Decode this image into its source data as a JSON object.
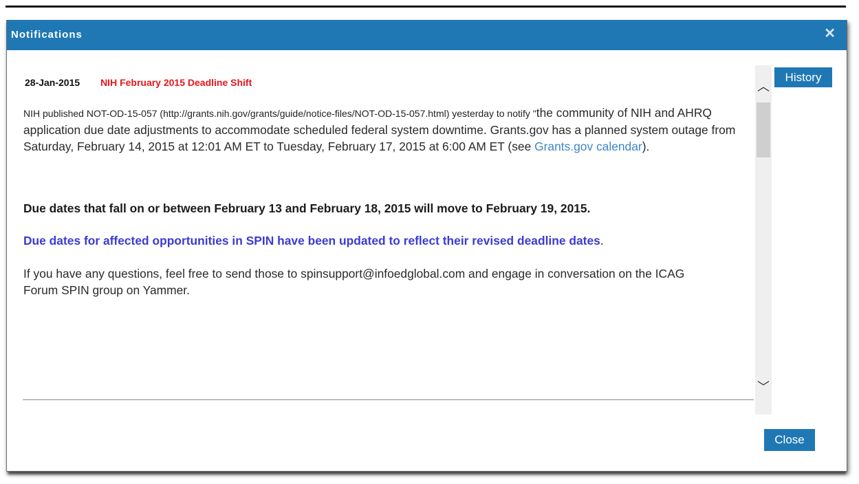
{
  "dialog": {
    "title": "Notifications",
    "close_glyph": "✕",
    "history_label": "History",
    "close_label": "Close",
    "scroll_up_glyph": "︿",
    "scroll_down_glyph": "﹀"
  },
  "notification": {
    "date": "28-Jan-2015",
    "title": "NIH February 2015 Deadline Shift",
    "body1_small": "NIH published NOT-OD-15-057 (http://grants.nih.gov/grants/guide/notice-files/NOT-OD-15-057.html) yesterday to notify \"",
    "body1_main": "the community of NIH and AHRQ application due date adjustments to accommodate scheduled federal system downtime. Grants.gov has a planned system outage from Saturday, February 14, 2015 at 12:01 AM ET to Tuesday, February 17, 2015 at 6:00 AM ET (see ",
    "body1_link": "Grants.gov calendar",
    "body1_end": ").",
    "body_bold": "Due dates that fall on or between February 13 and February 18, 2015 will move to February 19, 2015.",
    "body_blue": "Due dates for affected opportunities in SPIN have been updated to reflect their revised deadline dates",
    "body_blue_end": ".",
    "body3": "If you have any questions, feel free to send those to spinsupport@infoedglobal.com and engage in conversation on the ICAG Forum SPIN group on Yammer."
  },
  "colors": {
    "titlebar": "#1f78b4",
    "title_red": "#e8151b",
    "link_blue": "#3d86c6",
    "highlight_blue": "#3a3cd2"
  }
}
